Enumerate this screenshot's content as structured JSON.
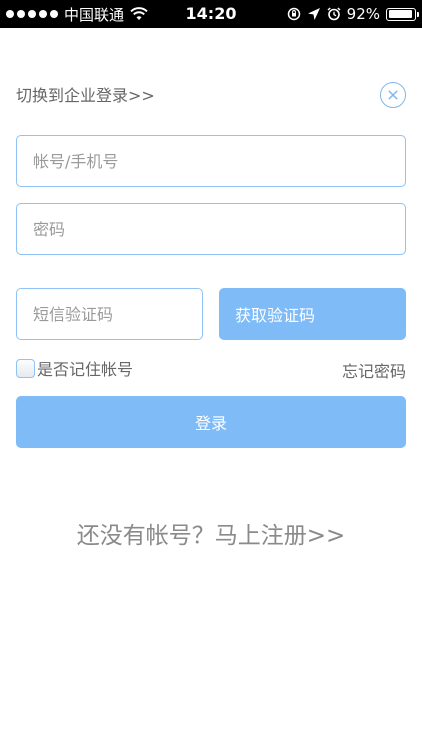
{
  "status_bar": {
    "carrier": "中国联通",
    "time": "14:20",
    "battery_percent": "92%",
    "battery_level": 0.92,
    "icons": [
      "signal-dots-icon",
      "wifi-icon",
      "orientation-lock-icon",
      "location-arrow-icon",
      "alarm-icon",
      "battery-icon"
    ]
  },
  "header": {
    "switch_enterprise_label": "切换到企业登录>>",
    "close_icon": "close-circle-icon"
  },
  "form": {
    "account_placeholder": "帐号/手机号",
    "password_placeholder": "密码",
    "sms_code_placeholder": "短信验证码",
    "get_code_label": "获取验证码",
    "remember_label": "是否记住帐号",
    "forgot_label": "忘记密码",
    "login_label": "登录"
  },
  "footer": {
    "register_label": "还没有帐号？马上注册>>"
  },
  "colors": {
    "accent": "#7fbbf7",
    "border": "#8fc2f5",
    "text_muted": "#666666"
  }
}
